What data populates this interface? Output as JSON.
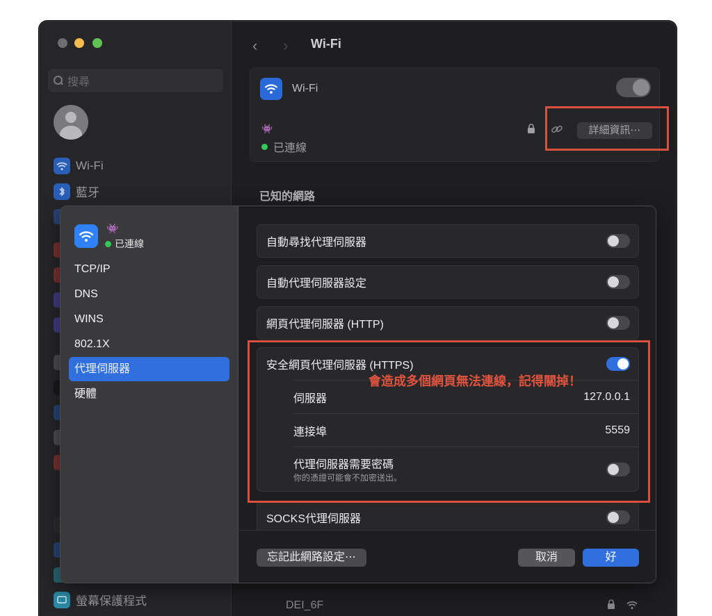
{
  "window": {
    "search_placeholder": "搜尋",
    "toolbar_title": "Wi-Fi",
    "sidebar_items": [
      {
        "label": "Wi-Fi"
      },
      {
        "label": "藍牙"
      },
      {
        "label": "螢幕保護程式"
      }
    ],
    "wifi_card": {
      "title": "Wi-Fi",
      "ssid": "👾",
      "status": "已連線",
      "details_button": "詳細資訊⋯"
    },
    "known_networks_title": "已知的網路",
    "known_network_row": "DEI_6F"
  },
  "dialog": {
    "ssid": "👾",
    "status": "已連線",
    "nav": [
      {
        "label": "TCP/IP",
        "active": false
      },
      {
        "label": "DNS",
        "active": false
      },
      {
        "label": "WINS",
        "active": false
      },
      {
        "label": "802.1X",
        "active": false
      },
      {
        "label": "代理伺服器",
        "active": true
      },
      {
        "label": "硬體",
        "active": false
      }
    ],
    "settings": {
      "auto_discovery": {
        "label": "自動尋找代理伺服器",
        "on": false
      },
      "auto_config": {
        "label": "自動代理伺服器設定",
        "on": false
      },
      "http": {
        "label": "網頁代理伺服器 (HTTP)",
        "on": false
      },
      "https": {
        "label": "安全網頁代理伺服器 (HTTPS)",
        "on": true,
        "server_label": "伺服器",
        "server_value": "127.0.0.1",
        "port_label": "連接埠",
        "port_value": "5559",
        "password_label": "代理伺服器需要密碼",
        "password_note": "你的憑證可能會不加密送出。",
        "password_on": false
      },
      "socks": {
        "label": "SOCKS代理伺服器",
        "on": false
      }
    },
    "buttons": {
      "forget": "忘記此網路設定⋯",
      "cancel": "取消",
      "ok": "好"
    }
  },
  "annotation": {
    "text": "會造成多個網頁無法連線，記得關掉！",
    "color": "#d9503e"
  }
}
